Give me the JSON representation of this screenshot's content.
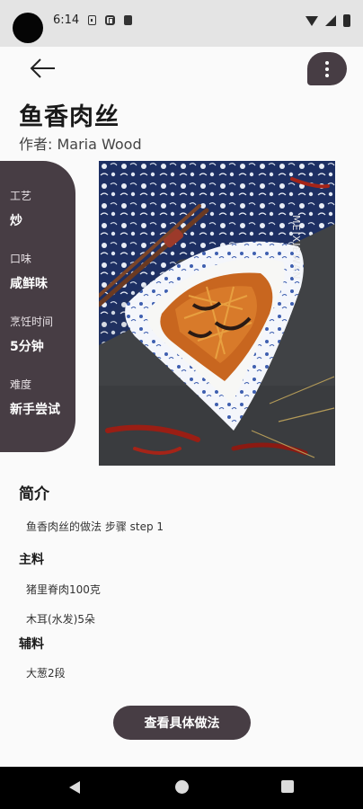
{
  "status_bar": {
    "time": "6:14",
    "icons": [
      "sim-card-icon",
      "p-icon",
      "sd-card-icon",
      "wifi-icon",
      "signal-icon",
      "battery-icon"
    ]
  },
  "header": {
    "back_icon": "arrow-left-icon",
    "more_icon": "more-vertical-icon"
  },
  "recipe": {
    "title": "鱼香肉丝",
    "author": "作者: Maria Wood"
  },
  "info": [
    {
      "label": "工艺",
      "value": "炒"
    },
    {
      "label": "口味",
      "value": "咸鲜味"
    },
    {
      "label": "烹饪时间",
      "value": "5分钟"
    },
    {
      "label": "难度",
      "value": "新手尝试"
    }
  ],
  "photo": {
    "watermark": "MEIXIEWAN",
    "alt": "dish-photo"
  },
  "intro": {
    "heading": "简介",
    "text": "鱼香肉丝的做法 步骤 step 1"
  },
  "main_ingredients": {
    "heading": "主料",
    "items": [
      "猪里脊肉100克",
      "木耳(水发)5朵"
    ]
  },
  "secondary_ingredients": {
    "heading": "辅料",
    "items": [
      "大葱2段"
    ]
  },
  "actions": {
    "view_steps": "查看具体做法"
  },
  "colors": {
    "accent": "#473d44",
    "background": "#fafafa",
    "status_bar": "#e4e4e4",
    "nav_bar": "#000000"
  }
}
